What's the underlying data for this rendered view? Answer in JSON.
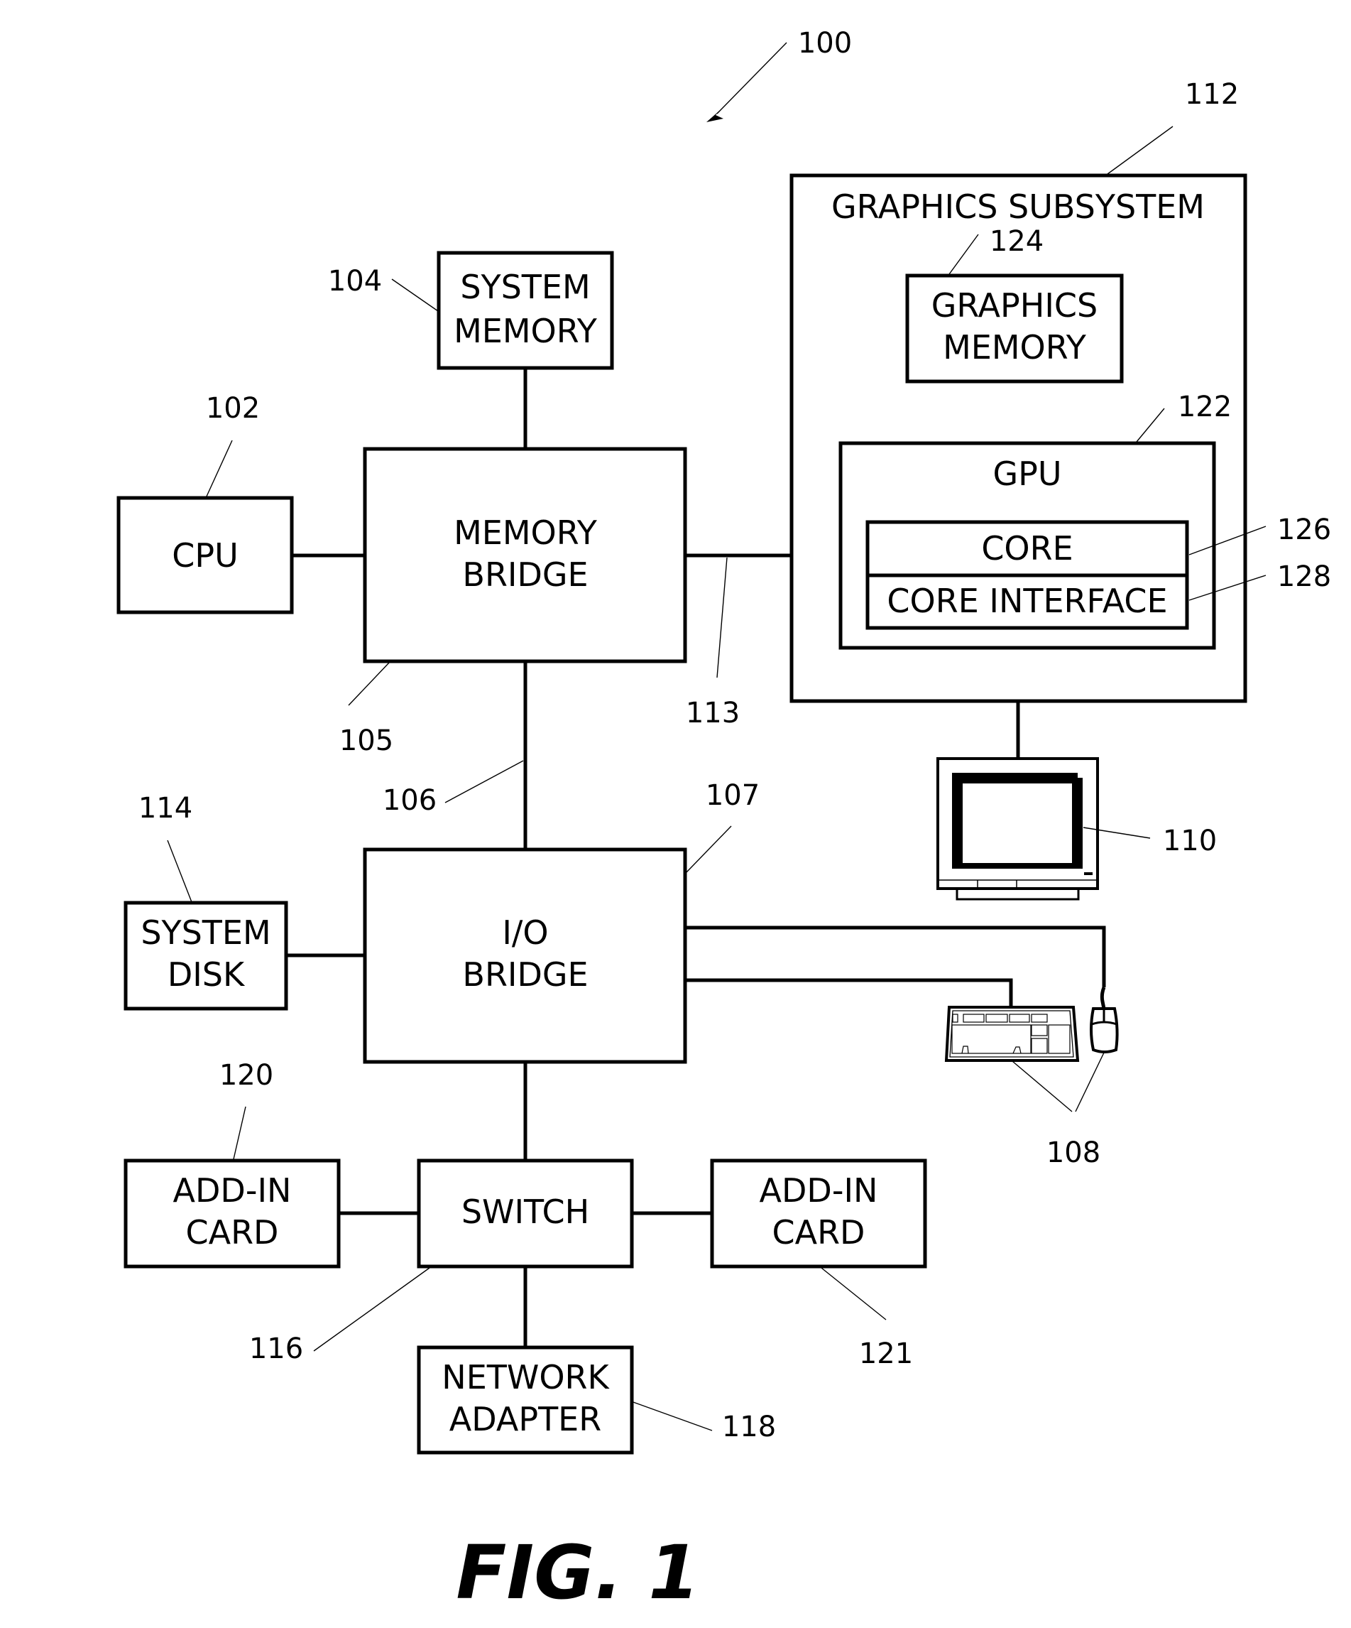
{
  "figure": {
    "title": "FIG. 1",
    "system_ref": "100"
  },
  "blocks": {
    "cpu": {
      "lines": [
        "CPU"
      ],
      "ref": "102"
    },
    "system_memory": {
      "lines": [
        "SYSTEM",
        "MEMORY"
      ],
      "ref": "104"
    },
    "memory_bridge": {
      "lines": [
        "MEMORY",
        "BRIDGE"
      ],
      "ref": "105"
    },
    "io_bridge": {
      "lines": [
        "I/O",
        "BRIDGE"
      ],
      "ref": "107"
    },
    "system_disk": {
      "lines": [
        "SYSTEM",
        "DISK"
      ],
      "ref": "114"
    },
    "switch": {
      "lines": [
        "SWITCH"
      ],
      "ref": "116"
    },
    "add_in_card_left": {
      "lines": [
        "ADD-IN",
        "CARD"
      ],
      "ref": "120"
    },
    "add_in_card_right": {
      "lines": [
        "ADD-IN",
        "CARD"
      ],
      "ref": "121"
    },
    "network_adapter": {
      "lines": [
        "NETWORK",
        "ADAPTER"
      ],
      "ref": "118"
    },
    "graphics_subsystem": {
      "lines": [
        "GRAPHICS SUBSYSTEM"
      ],
      "ref": "112"
    },
    "graphics_memory": {
      "lines": [
        "GRAPHICS",
        "MEMORY"
      ],
      "ref": "124"
    },
    "gpu": {
      "lines": [
        "GPU"
      ],
      "ref": "122"
    },
    "core": {
      "lines": [
        "CORE"
      ],
      "ref": "126"
    },
    "core_interface": {
      "lines": [
        "CORE INTERFACE"
      ],
      "ref": "128"
    }
  },
  "connections": {
    "bus_106": "106",
    "bus_113": "113"
  },
  "devices": {
    "display": {
      "ref": "110",
      "icon": "monitor-icon"
    },
    "input_devices": {
      "ref": "108",
      "icons": [
        "keyboard-icon",
        "mouse-icon"
      ]
    }
  }
}
